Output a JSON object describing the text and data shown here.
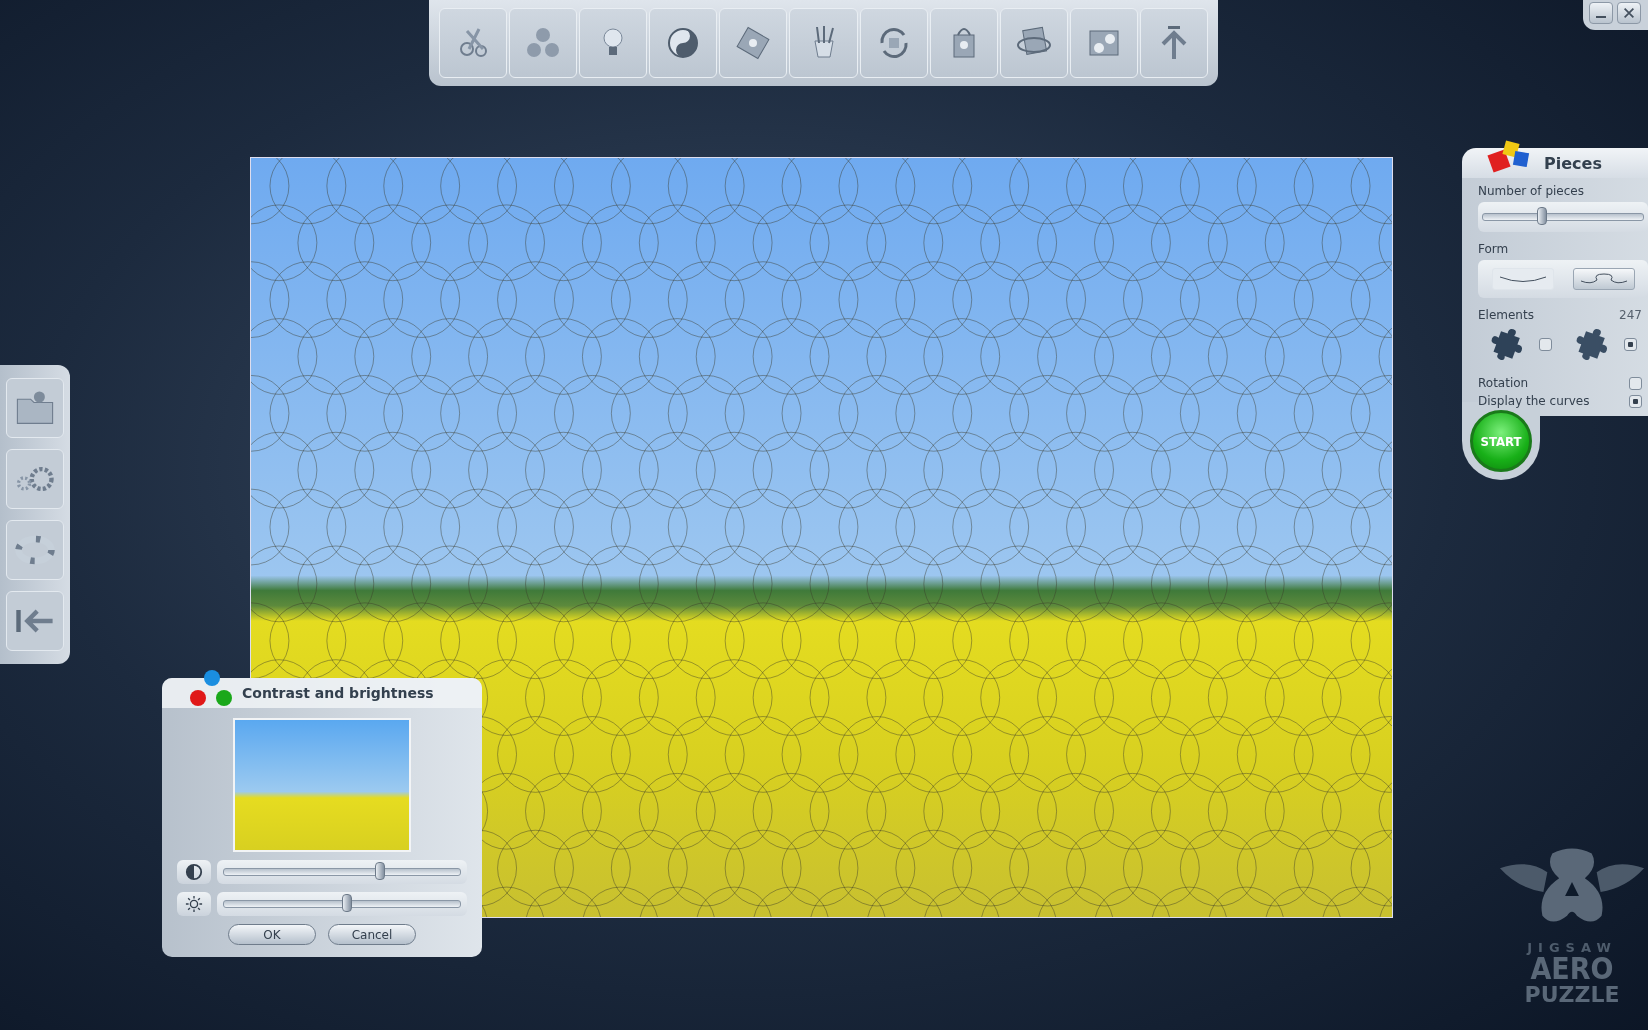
{
  "pieces_panel": {
    "title": "Pieces",
    "number_label": "Number of pieces",
    "number_slider": {
      "level": 0.37
    },
    "form_label": "Form",
    "forms": [
      {
        "kind": "smooth",
        "selected": false
      },
      {
        "kind": "wavy",
        "selected": true
      }
    ],
    "elements_label": "Elements",
    "elements_count": "247",
    "elements": [
      {
        "kind": "flat",
        "checked": false
      },
      {
        "kind": "shaded",
        "checked": true
      }
    ],
    "options": [
      {
        "label": "Rotation",
        "checked": false
      },
      {
        "label": "Display the curves",
        "checked": true
      }
    ],
    "start": "START"
  },
  "dialog": {
    "title": "Contrast and brightness",
    "sliders": [
      {
        "kind": "contrast",
        "level": 0.66
      },
      {
        "kind": "brightness",
        "level": 0.52
      }
    ],
    "buttons": [
      "OK",
      "Cancel"
    ]
  },
  "logo": {
    "line_1": "JIGSAW",
    "line_2": "AERO",
    "line_3": "PUZZLE"
  }
}
